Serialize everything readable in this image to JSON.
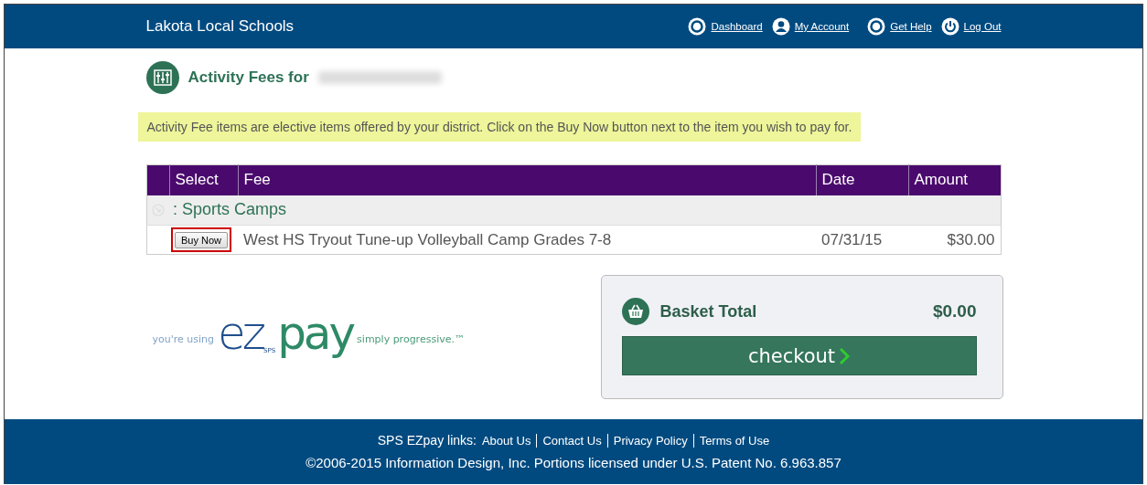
{
  "header": {
    "title": "Lakota Local Schools",
    "nav": [
      {
        "label": "Dashboard",
        "kind": "ring"
      },
      {
        "label": "My Account",
        "kind": "person"
      },
      {
        "label": "Get Help",
        "kind": "ring"
      },
      {
        "label": "Log Out",
        "kind": "power"
      }
    ]
  },
  "heading": {
    "title": "Activity Fees for",
    "name_redacted": true
  },
  "notice": "Activity Fee items are elective items offered by your district. Click on the Buy Now button next to the item you wish to pay for.",
  "table": {
    "columns": [
      "Select",
      "Fee",
      "Date",
      "Amount"
    ],
    "groups": [
      {
        "label": ": Sports Camps",
        "rows": [
          {
            "button": "Buy Now",
            "highlighted": true,
            "fee": "West HS Tryout Tune-up Volleyball Camp Grades 7-8",
            "date": "07/31/15",
            "amount": "$30.00"
          }
        ]
      }
    ]
  },
  "logo": {
    "before": "you're using",
    "brand_small": "SPS",
    "brand_ez": "ez",
    "brand_pay": "pay",
    "after": "simply progressive.™"
  },
  "basket": {
    "label": "Basket Total",
    "total": "$0.00",
    "button": "checkout"
  },
  "footer": {
    "links_label": "SPS EZpay links:",
    "links": [
      "About Us",
      "Contact Us",
      "Privacy Policy",
      "Terms of Use"
    ],
    "copyright": "©2006-2015 Information Design, Inc. Portions licensed under U.S. Patent No. 6.963.857"
  }
}
